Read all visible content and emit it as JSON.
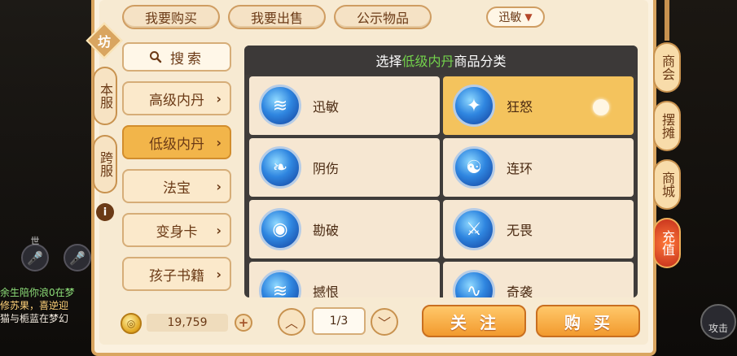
{
  "top_tabs": [
    {
      "label": "我要购买"
    },
    {
      "label": "我要出售"
    },
    {
      "label": "公示物品"
    }
  ],
  "server_select": {
    "value": "迅敏",
    "caret": "▼"
  },
  "left_side": {
    "badge": "坊",
    "tabs": [
      {
        "label": "本服"
      },
      {
        "label": "跨服"
      }
    ],
    "info": "i"
  },
  "search": {
    "icon": "search-icon",
    "label": "搜索"
  },
  "categories": [
    {
      "label": "高级内丹",
      "active": false
    },
    {
      "label": "低级内丹",
      "active": true
    },
    {
      "label": "法宝",
      "active": false
    },
    {
      "label": "变身卡",
      "active": false
    },
    {
      "label": "孩子书籍",
      "active": false
    }
  ],
  "grid": {
    "title_prefix": "选择",
    "title_highlight": "低级内丹",
    "title_suffix": "商品分类",
    "ghost_label": "迅敏",
    "items": [
      {
        "name": "迅敏",
        "icon": "claw-icon",
        "selected": false
      },
      {
        "name": "狂怒",
        "icon": "rage-icon",
        "selected": true
      },
      {
        "name": "阴伤",
        "icon": "fish-icon",
        "selected": false
      },
      {
        "name": "连环",
        "icon": "swirl-icon",
        "selected": false
      },
      {
        "name": "勘破",
        "icon": "eye-icon",
        "selected": false
      },
      {
        "name": "无畏",
        "icon": "sword-icon",
        "selected": false
      },
      {
        "name": "撼恨",
        "icon": "claw-icon",
        "selected": false
      },
      {
        "name": "奇袭",
        "icon": "wave-icon",
        "selected": false
      }
    ]
  },
  "currency": {
    "amount": "19,759",
    "add": "+"
  },
  "pagination": {
    "current": "1/3"
  },
  "actions": {
    "follow": "关注",
    "buy": "购买"
  },
  "right_side": [
    {
      "label": "商会"
    },
    {
      "label": "摆摊"
    },
    {
      "label": "商城"
    },
    {
      "label": "充值"
    }
  ],
  "chat": [
    {
      "text": "余生陪你浪0在梦",
      "color": "g"
    },
    {
      "text": "修苏果，喜逆迎",
      "color": "y"
    },
    {
      "text": "猫与栀蓝在梦幻",
      "color": "w"
    }
  ],
  "voice": {
    "label": "世"
  },
  "attack": {
    "label": "攻击"
  },
  "colors": {
    "accent": "#f2b54a",
    "panel": "#fbf1df",
    "highlight_green": "#73d24c"
  }
}
